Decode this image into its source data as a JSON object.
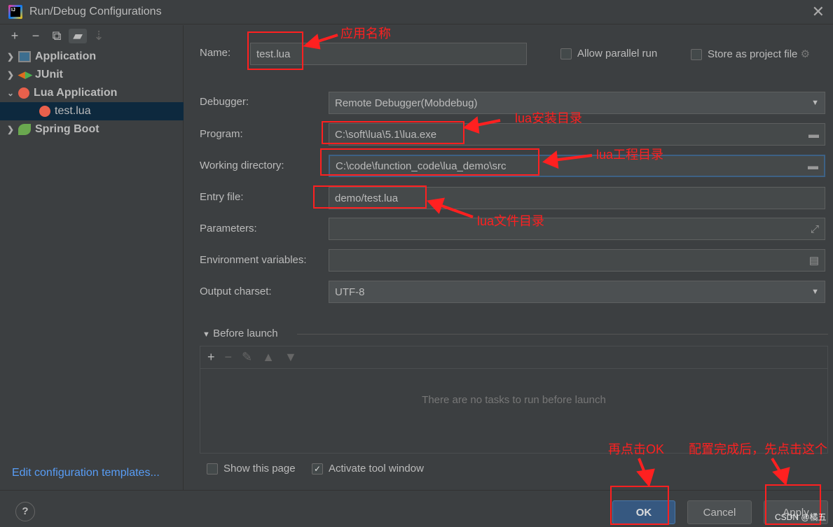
{
  "window": {
    "title": "Run/Debug Configurations",
    "close_icon": "close-icon"
  },
  "sidebar": {
    "toolbar": [
      "add-icon",
      "remove-icon",
      "copy-icon",
      "new-folder-icon",
      "sort-icon"
    ],
    "items": [
      {
        "label": "Application",
        "expanded": false
      },
      {
        "label": "JUnit",
        "expanded": false
      },
      {
        "label": "Lua Application",
        "expanded": true
      },
      {
        "label": "test.lua",
        "selected": true
      },
      {
        "label": "Spring Boot",
        "expanded": false
      }
    ],
    "edit_templates": "Edit configuration templates..."
  },
  "form": {
    "name_label": "Name:",
    "name_value": "test.lua",
    "allow_parallel": "Allow parallel run",
    "store_project": "Store as project file",
    "debugger_label": "Debugger:",
    "debugger_value": "Remote Debugger(Mobdebug)",
    "program_label": "Program:",
    "program_value": "C:\\soft\\lua\\5.1\\lua.exe",
    "workdir_label": "Working directory:",
    "workdir_value": "C:\\code\\function_code\\lua_demo\\src",
    "entry_label": "Entry file:",
    "entry_value": "demo/test.lua",
    "params_label": "Parameters:",
    "params_value": "",
    "env_label": "Environment variables:",
    "env_value": "",
    "charset_label": "Output charset:",
    "charset_value": "UTF-8",
    "before_launch": "Before launch",
    "no_tasks": "There are no tasks to run before launch",
    "show_page": "Show this page",
    "show_page_checked": false,
    "activate_tool": "Activate tool window",
    "activate_tool_checked": true
  },
  "buttons": {
    "help": "?",
    "ok": "OK",
    "cancel": "Cancel",
    "apply": "Apply"
  },
  "annotations": {
    "name": "应用名称",
    "program": "lua安装目录",
    "workdir": "lua工程目录",
    "entry": "lua文件目录",
    "ok": "再点击OK",
    "apply": "配置完成后，先点击这个"
  },
  "watermark": "CSDN @橘五",
  "colors": {
    "accent": "#365880",
    "selected": "#0d293e",
    "annotation": "#ff2020",
    "link": "#589df6"
  }
}
